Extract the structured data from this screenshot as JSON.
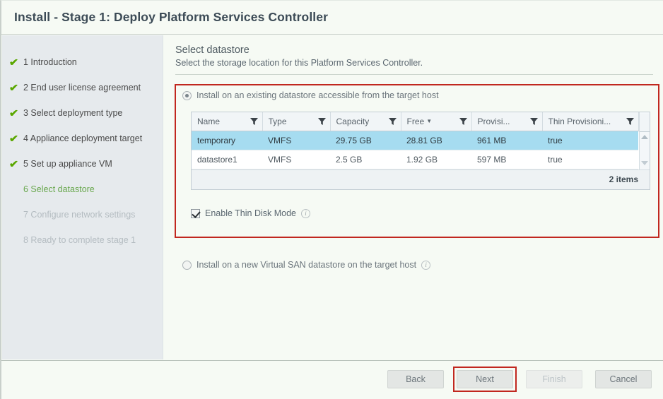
{
  "window": {
    "title": "Install - Stage 1: Deploy Platform Services Controller"
  },
  "sidebar": {
    "items": [
      {
        "label": "1 Introduction",
        "state": "done"
      },
      {
        "label": "2 End user license agreement",
        "state": "done"
      },
      {
        "label": "3 Select deployment type",
        "state": "done"
      },
      {
        "label": "4 Appliance deployment target",
        "state": "done"
      },
      {
        "label": "5 Set up appliance VM",
        "state": "done"
      },
      {
        "label": "6 Select datastore",
        "state": "current"
      },
      {
        "label": "7 Configure network settings",
        "state": "upcoming"
      },
      {
        "label": "8 Ready to complete stage 1",
        "state": "upcoming"
      }
    ]
  },
  "page": {
    "heading": "Select datastore",
    "subheading": "Select the storage location for this Platform Services Controller."
  },
  "options": {
    "existing_datastore_label": "Install on an existing datastore accessible from the target host",
    "existing_datastore_selected": true,
    "vsan_label": "Install on a new Virtual SAN datastore on the target host",
    "vsan_selected": false,
    "vsan_info_icon": "info-icon"
  },
  "table": {
    "columns": [
      {
        "label": "Name",
        "sorted": false,
        "filter_icon": "filter-icon"
      },
      {
        "label": "Type",
        "sorted": false,
        "filter_icon": "filter-icon"
      },
      {
        "label": "Capacity",
        "sorted": false,
        "filter_icon": "filter-icon"
      },
      {
        "label": "Free",
        "sorted": true,
        "sort_caret": "▼",
        "filter_icon": "filter-icon"
      },
      {
        "label": "Provisi...",
        "sorted": false,
        "filter_icon": "filter-icon"
      },
      {
        "label": "Thin Provisioni...",
        "sorted": false,
        "filter_icon": "filter-icon"
      }
    ],
    "rows": [
      {
        "selected": true,
        "name": "temporary",
        "type": "VMFS",
        "capacity": "29.75 GB",
        "free": "28.81 GB",
        "provisioned": "961 MB",
        "thin_provisioned": "true"
      },
      {
        "selected": false,
        "name": "datastore1",
        "type": "VMFS",
        "capacity": "2.5 GB",
        "free": "1.92 GB",
        "provisioned": "597 MB",
        "thin_provisioned": "true"
      }
    ],
    "footer_count": "2 items"
  },
  "thin_disk": {
    "label": "Enable Thin Disk Mode",
    "checked": true,
    "info_icon": "info-icon"
  },
  "footer": {
    "back": "Back",
    "next": "Next",
    "finish": "Finish",
    "cancel": "Cancel",
    "finish_disabled": true,
    "next_highlighted": true
  },
  "colors": {
    "highlight_box": "#c1271f",
    "selected_row": "#a6dcf0",
    "current_step": "#6aa84f",
    "check_green": "#5aa700",
    "sidebar_bg": "#e6eaed",
    "page_bg": "#f6faf4"
  }
}
